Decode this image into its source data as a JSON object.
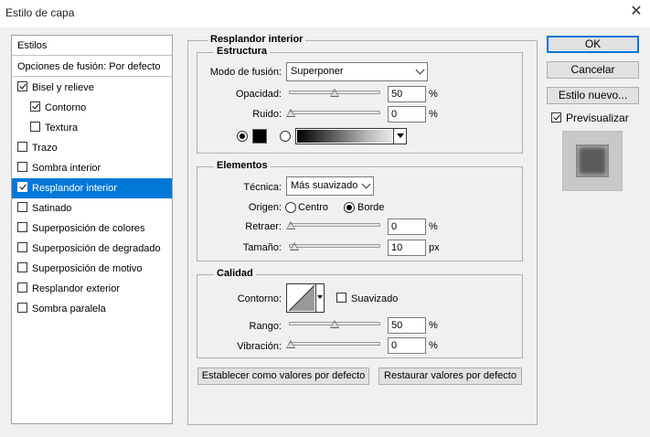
{
  "window": {
    "title": "Estilo de capa",
    "close_glyph": "✕"
  },
  "left_panel": {
    "header": "Estilos",
    "blend_options": "Opciones de fusión: Por defecto",
    "items": [
      {
        "label": "Bisel y relieve",
        "checked": true,
        "indent": false
      },
      {
        "label": "Contorno",
        "checked": true,
        "indent": true
      },
      {
        "label": "Textura",
        "checked": false,
        "indent": true
      },
      {
        "label": "Trazo",
        "checked": false,
        "indent": false
      },
      {
        "label": "Sombra interior",
        "checked": false,
        "indent": false
      },
      {
        "label": "Resplandor interior",
        "checked": true,
        "indent": false,
        "selected": true
      },
      {
        "label": "Satinado",
        "checked": false,
        "indent": false
      },
      {
        "label": "Superposición de colores",
        "checked": false,
        "indent": false
      },
      {
        "label": "Superposición de degradado",
        "checked": false,
        "indent": false
      },
      {
        "label": "Superposición de motivo",
        "checked": false,
        "indent": false
      },
      {
        "label": "Resplandor exterior",
        "checked": false,
        "indent": false
      },
      {
        "label": "Sombra paralela",
        "checked": false,
        "indent": false
      }
    ]
  },
  "main": {
    "title": "Resplandor interior",
    "structure": {
      "title": "Estructura",
      "blend_mode_label": "Modo de fusión:",
      "blend_mode_value": "Superponer",
      "opacity_label": "Opacidad:",
      "opacity_value": "50",
      "opacity_unit": "%",
      "opacity_level": 0.5,
      "noise_label": "Ruido:",
      "noise_value": "0",
      "noise_unit": "%",
      "noise_level": 0,
      "color_mode": "solid",
      "solid_color": "#000000"
    },
    "elements": {
      "title": "Elementos",
      "technique_label": "Técnica:",
      "technique_value": "Más suavizado",
      "source_label": "Origen:",
      "source_center": "Centro",
      "source_edge": "Borde",
      "source_selected": "edge",
      "choke_label": "Retraer:",
      "choke_value": "0",
      "choke_unit": "%",
      "choke_level": 0,
      "size_label": "Tamaño:",
      "size_value": "10",
      "size_unit": "px",
      "size_level": 0.04
    },
    "quality": {
      "title": "Calidad",
      "contour_label": "Contorno:",
      "antialias_label": "Suavizado",
      "antialias_checked": false,
      "range_label": "Rango:",
      "range_value": "50",
      "range_unit": "%",
      "range_level": 0.5,
      "jitter_label": "Vibración:",
      "jitter_value": "0",
      "jitter_unit": "%",
      "jitter_level": 0
    },
    "set_default": "Establecer como valores por defecto",
    "reset_default": "Restaurar valores por defecto"
  },
  "right": {
    "ok": "OK",
    "cancel": "Cancelar",
    "new_style": "Estilo nuevo...",
    "preview_label": "Previsualizar",
    "preview_checked": true
  }
}
